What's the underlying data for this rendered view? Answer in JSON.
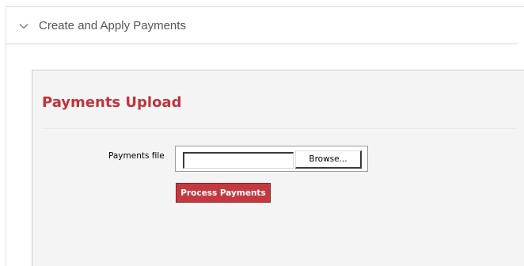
{
  "section": {
    "title": "Create and Apply Payments",
    "chevron_icon": "chevron-down-icon"
  },
  "panel": {
    "title": "Payments Upload",
    "file_label": "Payments file",
    "file_value": "",
    "browse_label": "Browse...",
    "process_label": "Process Payments"
  },
  "colors": {
    "accent": "#c0343a",
    "button_bg": "#c4393f",
    "panel_bg": "#f4f4f4"
  }
}
